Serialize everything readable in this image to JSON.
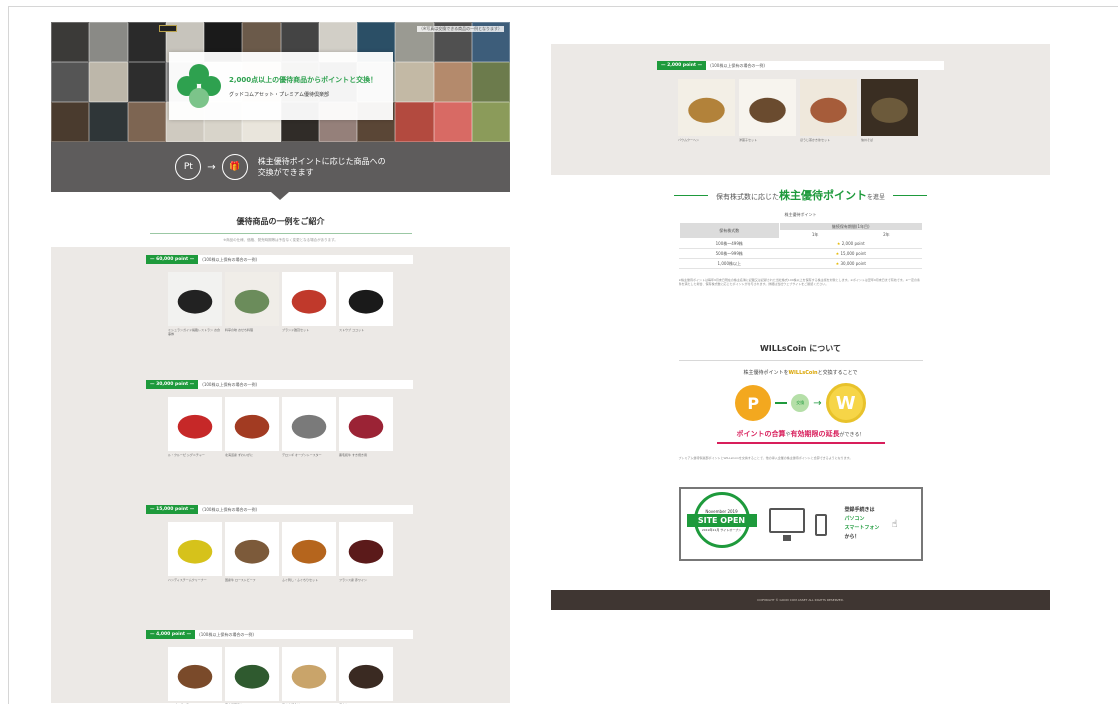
{
  "left_page": {
    "hero": {
      "headline": "2,000点以上の優待商品からポイントと交換！",
      "subline": "グッドコムアセット・プレミアム優待倶楽部",
      "top_note": "（※写真は交換できる商品の一例となります）",
      "tile_colors": [
        "#3b3a38",
        "#8a8a86",
        "#2a2a2a",
        "#c7c4bc",
        "#1a1a1a",
        "#6b5a4a",
        "#444",
        "#d2cfc7",
        "#2b4f66",
        "#9a9a92",
        "#505050",
        "#3d5d7a",
        "#555",
        "#bdb7aa",
        "#2d2d2d",
        "#888",
        "#eae8e2",
        "#ded7c9",
        "#4d4a45",
        "#2a2a2a",
        "#a0a49b",
        "#c3b9a5",
        "#b48a6c",
        "#6c7b4c",
        "#4a3b2e",
        "#2f3638",
        "#7d6552",
        "#cfcac0",
        "#d8d4ca",
        "#e9e5dc",
        "#302c28",
        "#95807a",
        "#5a4636",
        "#b34a3f",
        "#d86a64",
        "#8b9b5a"
      ]
    },
    "exchange_band": {
      "from_glyph": "Pt",
      "arrow": "→",
      "to_glyph": "🎁",
      "text_line1": "株主優待ポイントに応じた商品への",
      "text_line2": "交換ができます"
    },
    "section": {
      "title": "優待商品の一例をご紹介",
      "description": "※商品の仕様、価格、発売時期等は予告なく変更となる場合があります。"
    },
    "tiers": [
      {
        "badge": "— 60,000 point —",
        "label": "(100株以上保有の場合の一例)",
        "items": [
          {
            "color": "#f2f2f0",
            "accent": "#222",
            "caption": "ミシュランガイド掲載レストラン お食事券"
          },
          {
            "color": "#f0ede8",
            "accent": "#6b8c5b",
            "caption": "料亭の味 おせち料理"
          },
          {
            "color": "#ffffff",
            "accent": "#c0392b",
            "caption": "ブランド雑貨セット"
          },
          {
            "color": "#ffffff",
            "accent": "#1a1a1a",
            "caption": "ストウブ ココット"
          }
        ]
      },
      {
        "badge": "— 30,000 point —",
        "label": "(100株以上保有の場合の一例)",
        "items": [
          {
            "color": "#ffffff",
            "accent": "#c62828",
            "caption": "ル・クルーゼ シグニチャー"
          },
          {
            "color": "#ffffff",
            "accent": "#a23b22",
            "caption": "北海道産 ずわいがに"
          },
          {
            "color": "#ffffff",
            "accent": "#7a7a7a",
            "caption": "デロンギ オーブントースター"
          },
          {
            "color": "#ffffff",
            "accent": "#9b2335",
            "caption": "黒毛和牛 すき焼き用"
          }
        ]
      },
      {
        "badge": "— 15,000 point —",
        "label": "(100株以上保有の場合の一例)",
        "items": [
          {
            "color": "#ffffff",
            "accent": "#d6c21b",
            "caption": "ハンディスチームクリーナー"
          },
          {
            "color": "#ffffff",
            "accent": "#7c5a3a",
            "caption": "国産牛 ローストビーフ"
          },
          {
            "color": "#ffffff",
            "accent": "#b5651d",
            "caption": "ふぐ刺し・ふぐちりセット"
          },
          {
            "color": "#ffffff",
            "accent": "#5b1a1a",
            "caption": "フランス産 赤ワイン"
          }
        ]
      },
      {
        "badge": "— 4,000 point —",
        "label": "(100株以上保有の場合の一例)",
        "items": [
          {
            "color": "#ffffff",
            "accent": "#7a4a2a",
            "caption": "ハンバーグステーキ"
          },
          {
            "color": "#ffffff",
            "accent": "#2f5a2f",
            "caption": "京の和菓子セット"
          },
          {
            "color": "#ffffff",
            "accent": "#c9a46a",
            "caption": "天ぷら詰合せ"
          },
          {
            "color": "#ffffff",
            "accent": "#3a2a22",
            "caption": "焼肉セット"
          }
        ]
      }
    ]
  },
  "right_page": {
    "promo": {
      "badge": "— 2,000 point —",
      "label": "(100株以上保有の場合の一例)",
      "items": [
        {
          "color": "#f3efe6",
          "accent": "#b2823a",
          "caption": "バウムクーヘン"
        },
        {
          "color": "#f7f4ee",
          "accent": "#6a4b2f",
          "caption": "洋菓子セット"
        },
        {
          "color": "#efe8dc",
          "accent": "#a65c3a",
          "caption": "ほうじ茶かき氷セット"
        },
        {
          "color": "#3a2e22",
          "accent": "#6c5a3b",
          "caption": "信州そば"
        }
      ]
    },
    "points_section": {
      "prefix": "保有株式数に応じた",
      "highlight": "株主優待ポイント",
      "suffix": "を進呈",
      "table_caption": "株主優待ポイント",
      "col_holding": "保有株式数",
      "col_years": "継続保有期間(1年目)",
      "sub_col_a": "1年",
      "sub_col_b": "2年",
      "rows": [
        {
          "shares": "100株～499株",
          "points": "2,000 point"
        },
        {
          "shares": "500株～999株",
          "points": "15,000 point"
        },
        {
          "shares": "1,000株以上",
          "points": "30,000 point"
        }
      ],
      "fine_print": "※株主優待ポイントは毎年9月末日現在の株主名簿に記載又は記録された当社株式100株以上を保有する株主様を対象とします。※ポイントは翌年9月末日まで有効です。※一定の条件を満たした場合、保有株式数に応じたポイントが付与されます。詳細は当社ウェブサイトをご確認ください。"
    },
    "willscoin": {
      "title": "WILLsCoin について",
      "sub_prefix": "株主優待ポイントを",
      "sub_brand": "WILLsCoin",
      "sub_suffix": "と交換することで",
      "point_glyph": "P",
      "swap_label": "交換",
      "coin_glyph": "W",
      "merit_a": "ポイントの合算",
      "merit_mid": "や",
      "merit_b": "有効期限の延長",
      "merit_end": "ができる！",
      "fine_print": "プレミアム優待倶楽部ポイントとWILLsCoinを交換することで、他の導入企業の株主優待ポイントと合算できるようになります。"
    },
    "banner": {
      "badge_top": "November 2019",
      "badge_main": "SITE OPEN",
      "badge_bottom": "2019年11月 サイトオープン",
      "reg_line1": "登録手続きは",
      "reg_line2": "パソコン",
      "reg_line3": "スマートフォン",
      "reg_line4": "から！"
    },
    "footer": {
      "copyright": "COPYRIGHT © GOOD COM ASSET ALL RIGHTS RESERVED."
    }
  }
}
